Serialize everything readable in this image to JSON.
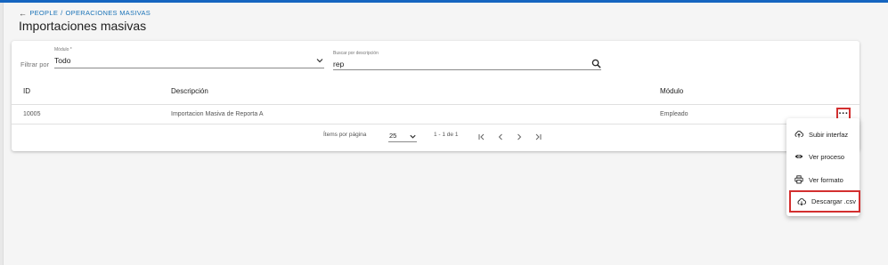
{
  "breadcrumb": {
    "parent": "PEOPLE",
    "separator": "/",
    "current": "OPERACIONES MASIVAS"
  },
  "page_title": "Importaciones masivas",
  "filters": {
    "filter_label": "Filtrar por",
    "module": {
      "label": "Módulo *",
      "value": "Todo"
    },
    "search": {
      "label": "Buscar por descripción",
      "value": "rep"
    }
  },
  "table": {
    "columns": [
      "ID",
      "Descripción",
      "Módulo"
    ],
    "rows": [
      {
        "id": "10005",
        "description": "Importacion Masiva de Reporta A",
        "module": "Empleado"
      }
    ],
    "more_icon": "more-horizontal-icon"
  },
  "paginator": {
    "items_label": "Ítems por página",
    "page_size": "25",
    "range": "1 - 1 de 1",
    "icons": [
      "first-page-icon",
      "prev-page-icon",
      "next-page-icon",
      "last-page-icon"
    ]
  },
  "action_menu": {
    "items": [
      {
        "label": "Subir interfaz",
        "icon": "upload-cloud-icon"
      },
      {
        "label": "Ver proceso",
        "icon": "eye-icon"
      },
      {
        "label": "Ver formato",
        "icon": "printer-icon"
      },
      {
        "label": "Descargar .csv",
        "icon": "download-cloud-icon"
      }
    ]
  },
  "colors": {
    "accent": "#1565c0",
    "link": "#1a73b8",
    "highlight": "#d32f2f"
  }
}
